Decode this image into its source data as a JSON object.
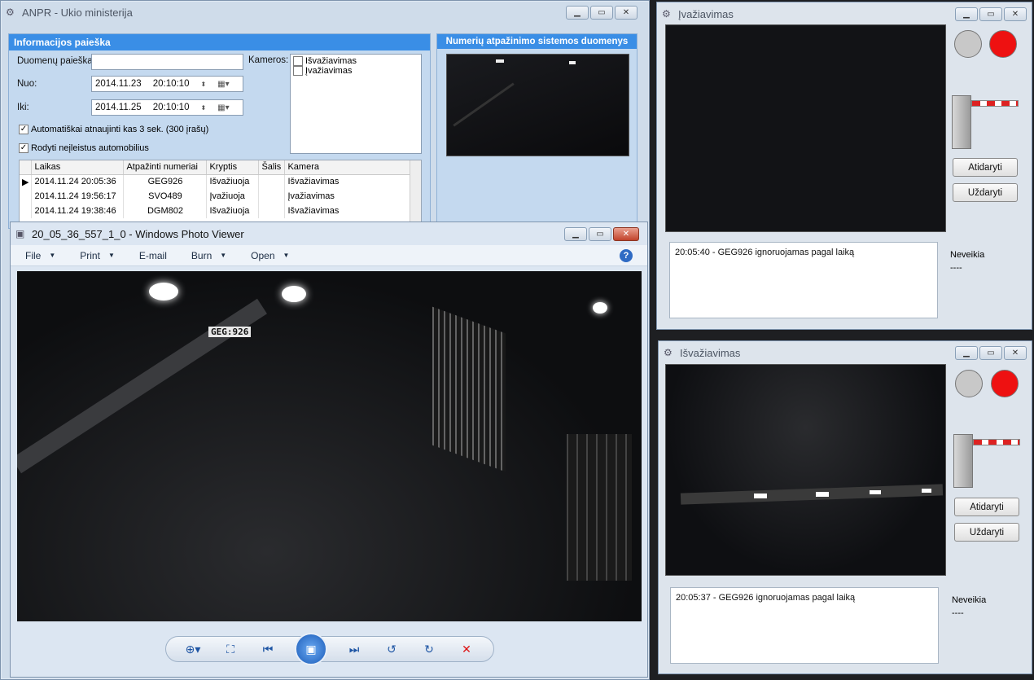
{
  "anpr": {
    "title": "ANPR - Ukio ministerija",
    "search_panel": {
      "header": "Informacijos paieška",
      "search_label": "Duomenų paieška",
      "search_value": "",
      "from_label": "Nuo:",
      "from_date": "2014.11.23",
      "from_time": "20:10:10",
      "to_label": "Iki:",
      "to_date": "2014.11.25",
      "to_time": "20:10:10",
      "auto_refresh": "Automatiškai atnaujinti kas 3 sek. (300 įrašų)",
      "show_unauthorized": "Rodyti neįleistus automobilius",
      "cameras_label": "Kameros:",
      "cameras": [
        "Išvažiavimas",
        "Įvažiavimas"
      ]
    },
    "table": {
      "columns": [
        "Laikas",
        "Atpažinti numeriai",
        "Kryptis",
        "Šalis",
        "Kamera"
      ],
      "rows": [
        {
          "time": "2014.11.24 20:05:36",
          "plate": "GEG926",
          "dir": "Išvažiuoja",
          "country": "",
          "camera": "Išvažiavimas"
        },
        {
          "time": "2014.11.24 19:56:17",
          "plate": "SVO489",
          "dir": "Įvažiuoja",
          "country": "",
          "camera": "Įvažiavimas"
        },
        {
          "time": "2014.11.24 19:38:46",
          "plate": "DGM802",
          "dir": "Išvažiuoja",
          "country": "",
          "camera": "Išvažiavimas"
        }
      ]
    },
    "recognition_header": "Numerių atpažinimo sistemos duomenys"
  },
  "photo_viewer": {
    "title": "20_05_36_557_1_0 - Windows Photo Viewer",
    "menu": [
      "File",
      "Print",
      "E-mail",
      "Burn",
      "Open"
    ],
    "plate_text": "GEG:926"
  },
  "entry_cam": {
    "title": "Įvažiavimas",
    "open_label": "Atidaryti",
    "close_label": "Uždaryti",
    "log": "20:05:40 - GEG926 ignoruojamas pagal laiką",
    "status": "Neveikia",
    "status_sub": "----"
  },
  "exit_cam": {
    "title": "Išvažiavimas",
    "open_label": "Atidaryti",
    "close_label": "Uždaryti",
    "log": "20:05:37 - GEG926 ignoruojamas pagal laiką",
    "status": "Neveikia",
    "status_sub": "----"
  },
  "colors": {
    "accent": "#3a8ee6",
    "red_light": "#ee1111",
    "grey_light": "#c8c8c8"
  }
}
